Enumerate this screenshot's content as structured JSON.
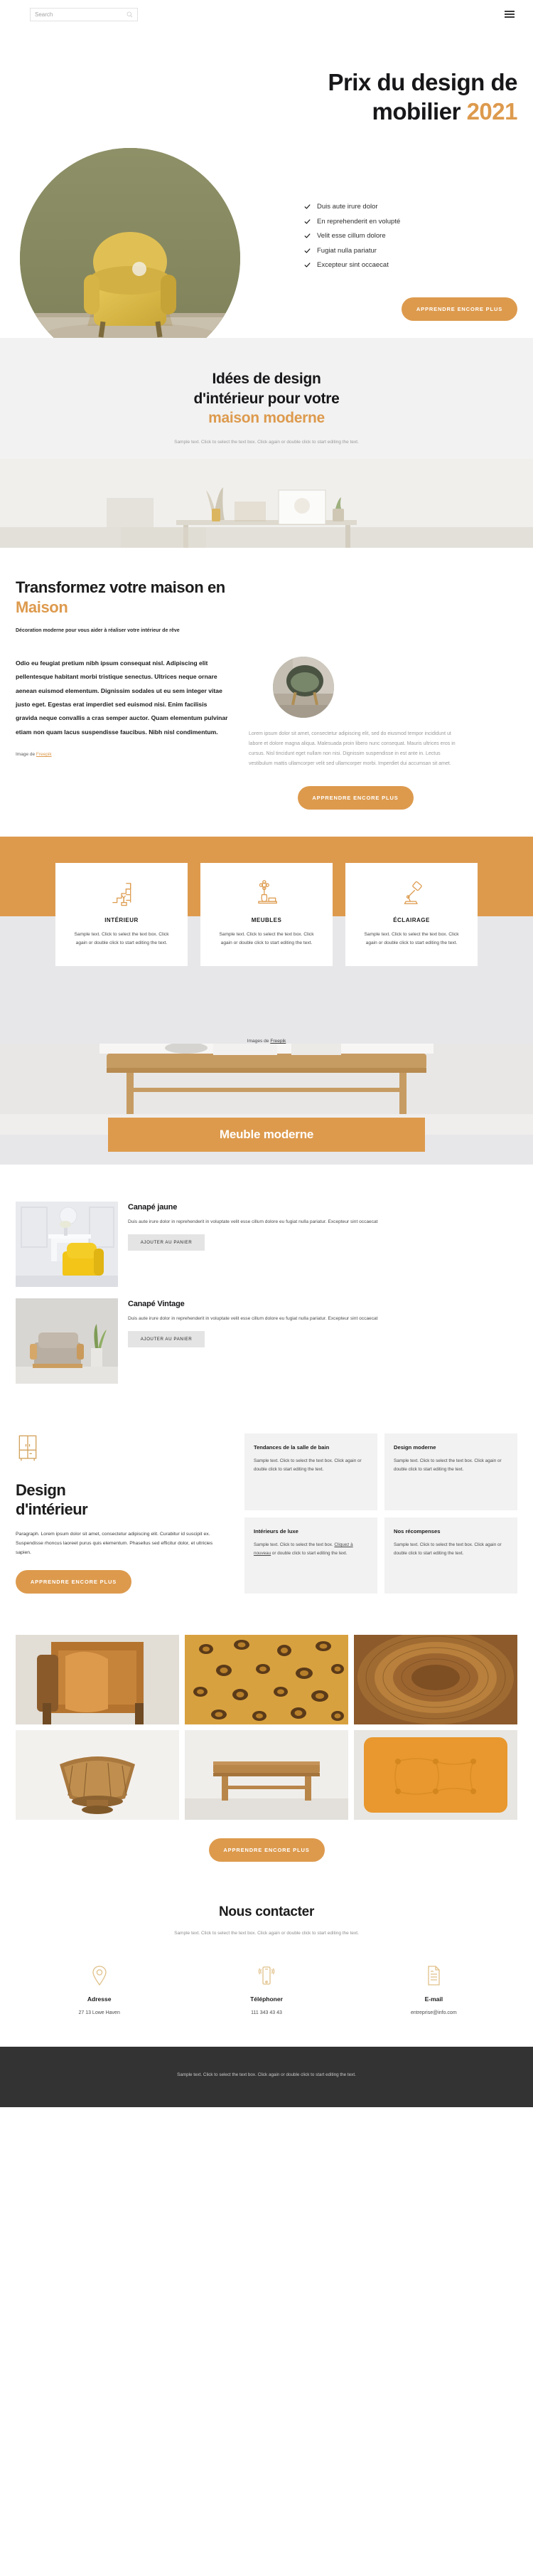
{
  "topbar": {
    "search_placeholder": "Search",
    "search_value": ""
  },
  "hero": {
    "title_line1": "Prix du design de",
    "title_line2": "mobilier ",
    "title_year": "2021",
    "bullets": [
      "Duis aute irure dolor",
      "En reprehenderit en volupté",
      "Velit esse cillum dolore",
      "Fugiat nulla pariatur",
      "Excepteur sint occaecat"
    ],
    "cta": "APPRENDRE ENCORE PLUS"
  },
  "ideas": {
    "title_line1": "Idées de design",
    "title_line2": "d'intérieur pour votre",
    "title_accent": "maison moderne",
    "sample": "Sample text. Click to select the text box. Click again or double click to start editing the text."
  },
  "transform": {
    "title": "Transformez votre maison en",
    "title_accent": "Maison",
    "kicker": "Décoration moderne pour vous aider à réaliser votre intérieur de rêve",
    "body_strong": "Odio eu feugiat pretium nibh ipsum consequat nisl. Adipiscing elit pellentesque habitant morbi tristique senectus. Ultrices neque ornare aenean euismod elementum. Dignissim sodales ut eu sem integer vitae justo eget. Egestas erat imperdiet sed euismod nisi. Enim facilisis gravida neque convallis a cras semper auctor. Quam elementum pulvinar etiam non quam lacus suspendisse faucibus. Nibh nisl condimentum.",
    "credit_prefix": "Image de ",
    "credit_link": "Freepik",
    "body_muted": "Lorem ipsum dolor sit amet, consectetur adipiscing elit, sed do eiusmod tempor incididunt ut labore et dolore magna aliqua. Malesuada proin libero nunc consequat. Mauris ultrices eros in cursus. Nisl tincidunt eget nullam non nisi. Dignissim suspendisse in est ante in. Lectus vestibulum mattis ullamcorper velit sed ullamcorper morbi. Imperdiet dui accumsan sit amet.",
    "cta": "APPRENDRE ENCORE PLUS"
  },
  "features": {
    "cards": [
      {
        "icon": "stairs-plant-icon",
        "title": "INTÉRIEUR",
        "text": "Sample text. Click to select the text box. Click again or double click to start editing the text."
      },
      {
        "icon": "vase-flower-icon",
        "title": "MEUBLES",
        "text": "Sample text. Click to select the text box. Click again or double click to start editing the text."
      },
      {
        "icon": "desk-lamp-icon",
        "title": "ÉCLAIRAGE",
        "text": "Sample text. Click to select the text box. Click again or double click to start editing the text."
      }
    ],
    "credit_prefix": "Images de ",
    "credit_link": "Freepik",
    "banner": "Meuble moderne"
  },
  "products": [
    {
      "name": "Canapé jaune",
      "text": "Duis aute irure dolor in reprehenderit in voluptate velit esse cillum dolore eu fugiat nulla pariatur. Excepteur sint occaecat",
      "cta": "AJOUTER AU PANIER"
    },
    {
      "name": "Canapé Vintage",
      "text": "Duis aute irure dolor in reprehenderit in voluptate velit esse cillum dolore eu fugiat nulla pariatur. Excepteur sint occaecat",
      "cta": "AJOUTER AU PANIER"
    }
  ],
  "design": {
    "icon": "cabinet-icon",
    "title_line1": "Design",
    "title_line2": "d'intérieur",
    "paragraph": "Paragraph. Lorem ipsum dolor sit amet, consectetur adipiscing elit. Curabitur id suscipit ex. Suspendisse rhoncus laoreet purus quis elementum. Phasellus sed efficitur dolor, et ultricies sapien.",
    "cta": "APPRENDRE ENCORE PLUS",
    "cards": [
      {
        "title": "Tendances de la salle de bain",
        "text": "Sample text. Click to select the text box. Click again or double click to start editing the text."
      },
      {
        "title": "Design moderne",
        "text": "Sample text. Click to select the text box. Click again or double click to start editing the text."
      },
      {
        "title": "Intérieurs de luxe",
        "text_before": "Sample text. Click to select the text box. ",
        "link": "Cliquez à nouveau",
        "text_after": " or double click to start editing the text."
      },
      {
        "title": "Nos récompenses",
        "text": "Sample text. Click to select the text box. Click again or double click to start editing the text."
      }
    ]
  },
  "gallery": {
    "cta": "APPRENDRE ENCORE PLUS",
    "cells": [
      "chair-with-blanket-photo",
      "leopard-print-photo",
      "wicker-basket-photo",
      "rattan-bowl-photo",
      "wooden-bench-photo",
      "orange-cushion-photo"
    ]
  },
  "contact": {
    "title": "Nous contacter",
    "sample": "Sample text. Click to select the text box. Click again or double click to start editing the text.",
    "items": [
      {
        "icon": "location-pin-icon",
        "label": "Adresse",
        "value": "27 13 Lowe Haven"
      },
      {
        "icon": "mobile-phone-icon",
        "label": "Téléphoner",
        "value": "111 343 43 43"
      },
      {
        "icon": "document-icon",
        "label": "E-mail",
        "value": "entreprise@info.com"
      }
    ]
  },
  "footer": {
    "text": "Sample text. Click to select the text box. Click again or double click to start editing the text."
  },
  "colors": {
    "accent": "#dd9a4d",
    "dark": "#333333",
    "light_grey": "#f2f2f2"
  }
}
